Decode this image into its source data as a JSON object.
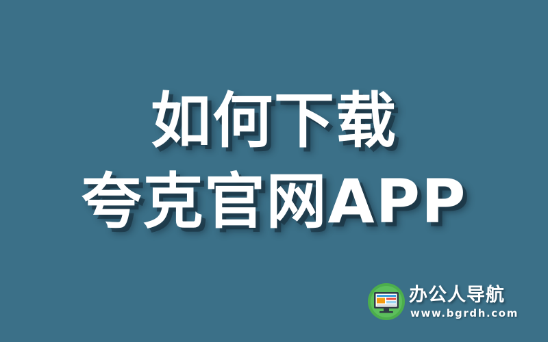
{
  "headline": {
    "line1": "如何下载",
    "line2": "夸克官网APP"
  },
  "brand": {
    "name": "办公人导航",
    "url": "www.bgrdh.com",
    "logo_icon": "monitor-icon"
  },
  "colors": {
    "background": "#3b7088",
    "text": "#ffffff",
    "logo_circle": "#4cae4c",
    "logo_screen_frame": "#2f3b45",
    "logo_accent_orange": "#f39c12",
    "logo_accent_blue": "#3aa0e0",
    "logo_accent_red": "#e74c3c"
  }
}
